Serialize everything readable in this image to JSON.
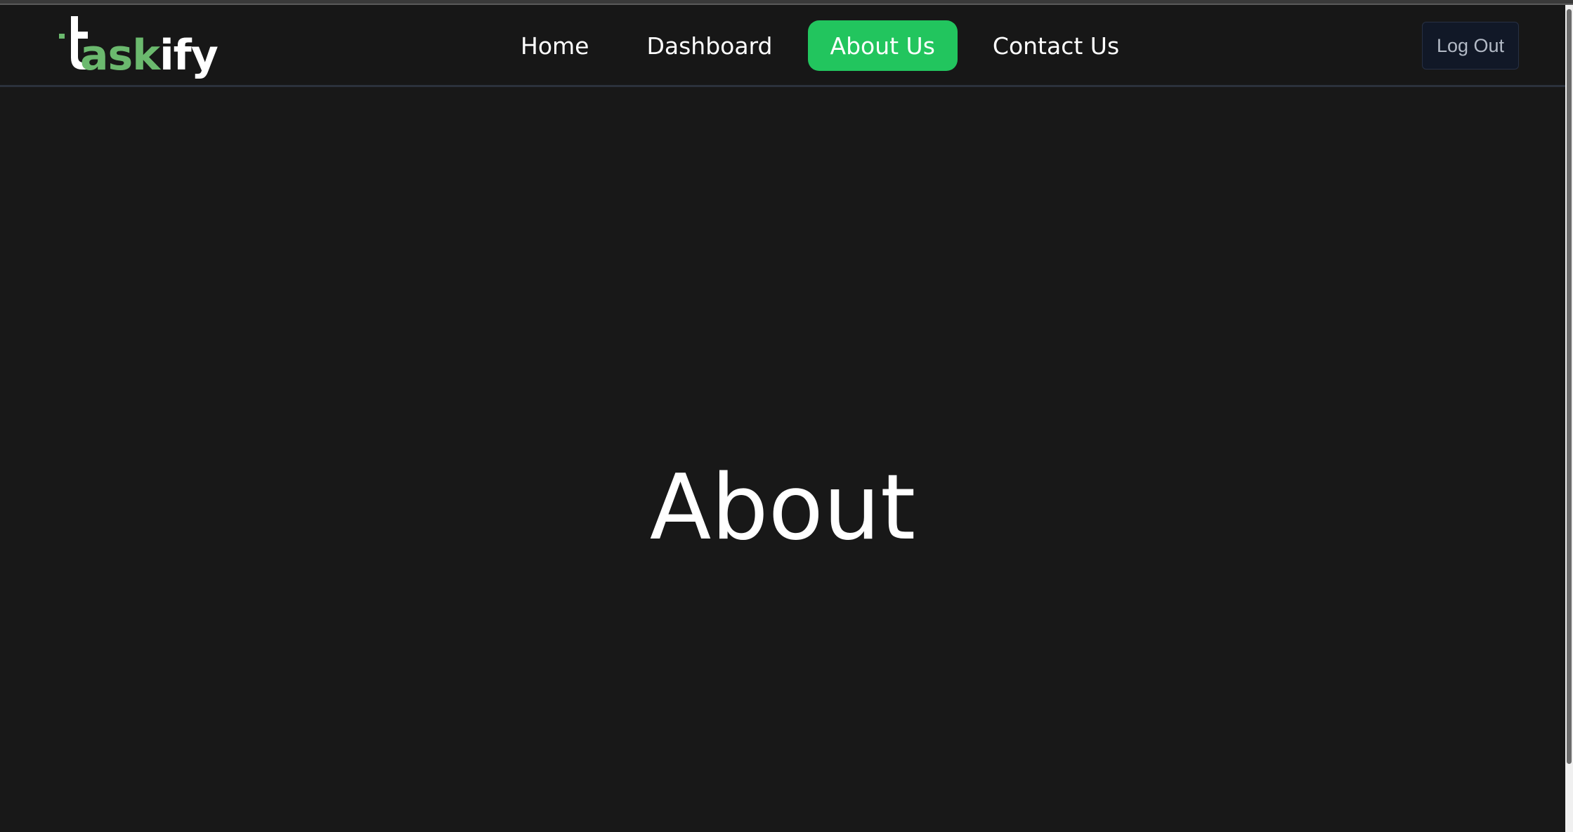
{
  "brand": {
    "name_prefix": "t",
    "name_green": "ask",
    "name_white": "ify",
    "accent_color": "#6bb96e"
  },
  "nav": {
    "items": [
      {
        "label": "Home",
        "active": false
      },
      {
        "label": "Dashboard",
        "active": false
      },
      {
        "label": "About Us",
        "active": true
      },
      {
        "label": "Contact Us",
        "active": false
      }
    ],
    "active_color": "#22c55e"
  },
  "header": {
    "logout_label": "Log Out"
  },
  "main": {
    "heading": "About"
  }
}
